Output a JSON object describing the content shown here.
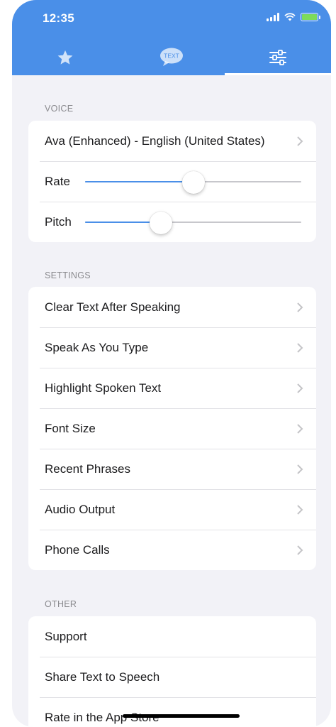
{
  "status_bar": {
    "time": "12:35",
    "battery_color": "#7ddb5a"
  },
  "tabs": [
    {
      "icon": "star-icon",
      "active": false
    },
    {
      "icon": "speech-bubble-icon",
      "text": "TEXT",
      "active": false
    },
    {
      "icon": "sliders-icon",
      "active": true
    }
  ],
  "accent_color": "#4a8fe8",
  "voice": {
    "header": "VOICE",
    "voice_name": "Ava (Enhanced) - English (United States)",
    "rate_label": "Rate",
    "rate_value": 0.5,
    "pitch_label": "Pitch",
    "pitch_value": 0.35
  },
  "settings": {
    "header": "SETTINGS",
    "items": [
      {
        "label": "Clear Text After Speaking"
      },
      {
        "label": "Speak As You Type"
      },
      {
        "label": "Highlight Spoken Text"
      },
      {
        "label": "Font Size"
      },
      {
        "label": "Recent Phrases"
      },
      {
        "label": "Audio Output"
      },
      {
        "label": "Phone Calls"
      }
    ]
  },
  "other": {
    "header": "OTHER",
    "items": [
      {
        "label": "Support"
      },
      {
        "label": "Share Text to Speech"
      },
      {
        "label": "Rate in the App Store"
      }
    ]
  }
}
